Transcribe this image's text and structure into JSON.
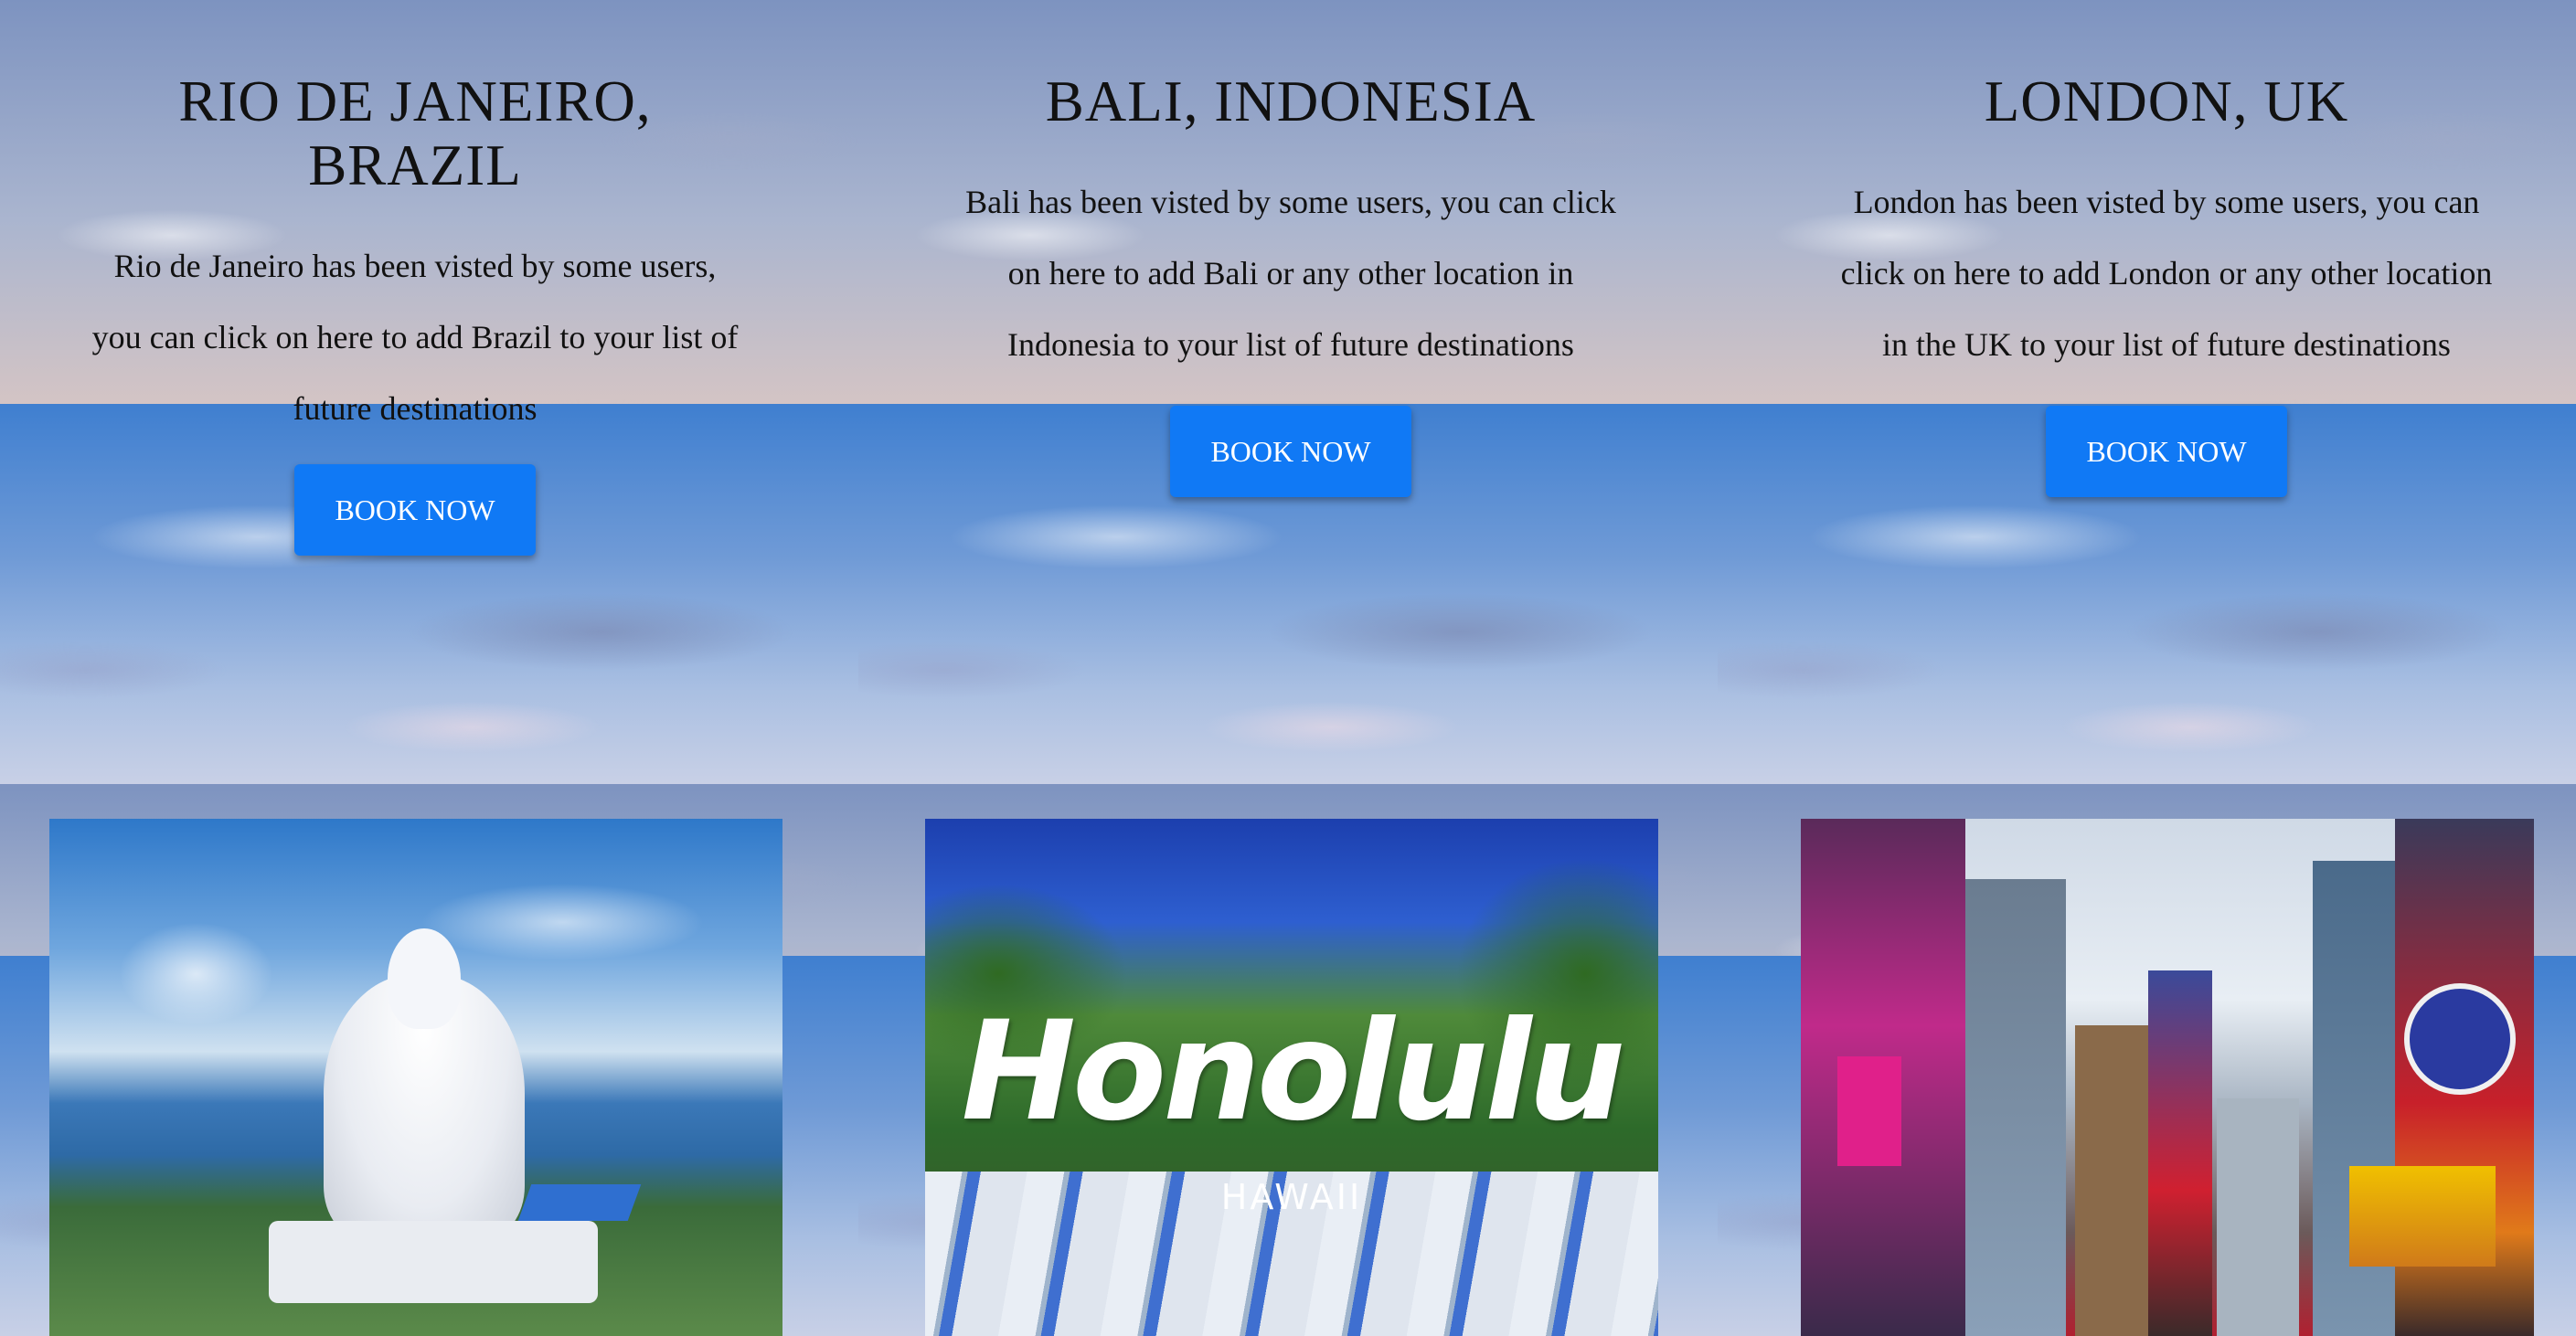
{
  "destinations": [
    {
      "title": "RIO DE JANEIRO, BRAZIL",
      "title_line1": "RIO DE JANEIRO,",
      "title_line2": "BRAZIL",
      "description": "Rio de Janeiro has been visted by some users, you can click on here to add Brazil to your list of future destinations",
      "button_label": "BOOK NOW",
      "image_icon": "buddha-statue-photo"
    },
    {
      "title": "BALI, INDONESIA",
      "description": "Bali has been visted by some users, you can click on here to add Bali or any other location in Indonesia to your list of future destinations",
      "button_label": "BOOK NOW",
      "image_icon": "honolulu-photo",
      "image_text": "Honolulu",
      "image_subtext": "HAWAII"
    },
    {
      "title": "LONDON, UK",
      "description": "London has been visted by some users, you can click on here to add London or any other location in the UK to your list of future destinations",
      "button_label": "BOOK NOW",
      "image_icon": "times-square-photo"
    }
  ],
  "colors": {
    "button": "#1079f5",
    "button_text": "#ffffff",
    "text": "#111111"
  }
}
